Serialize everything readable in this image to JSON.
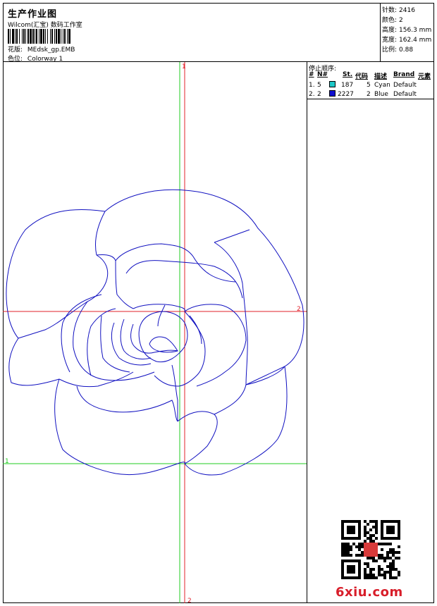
{
  "header": {
    "title": "生产作业图",
    "subtitle": "Wilcom(汇宝) 数码工作室",
    "design_label": "花版:",
    "design_value": "MEdsk_gp.EMB",
    "colorway_label": "色位:",
    "colorway_value": "Colorway 1"
  },
  "stats": [
    {
      "label": "针数:",
      "value": "2416"
    },
    {
      "label": "颜色:",
      "value": "2"
    },
    {
      "label": "高度:",
      "value": "156.3 mm"
    },
    {
      "label": "宽度:",
      "value": "162.4 mm"
    },
    {
      "label": "比例:",
      "value": "0.88"
    }
  ],
  "stop_sequence": {
    "title": "停止顺序:",
    "columns": [
      "#",
      "N#",
      "St.",
      "代码",
      "描述",
      "Brand",
      "元素"
    ],
    "rows": [
      {
        "index": "1.",
        "needle": "5",
        "stitches": "187",
        "code": "5",
        "description": "Cyan",
        "brand": "Default",
        "color": "#1ec8c8"
      },
      {
        "index": "2.",
        "needle": "2",
        "stitches": "2227",
        "code": "2",
        "description": "Blue",
        "brand": "Default",
        "color": "#1010d0"
      }
    ]
  },
  "guides": {
    "marker_top": "1",
    "marker_right": "2",
    "marker_left": "1",
    "marker_bottom": "2",
    "red_color": "#e0202a",
    "green_color": "#22cc22"
  },
  "design_color": "#1010c0",
  "logo_text": "6xiu.com"
}
